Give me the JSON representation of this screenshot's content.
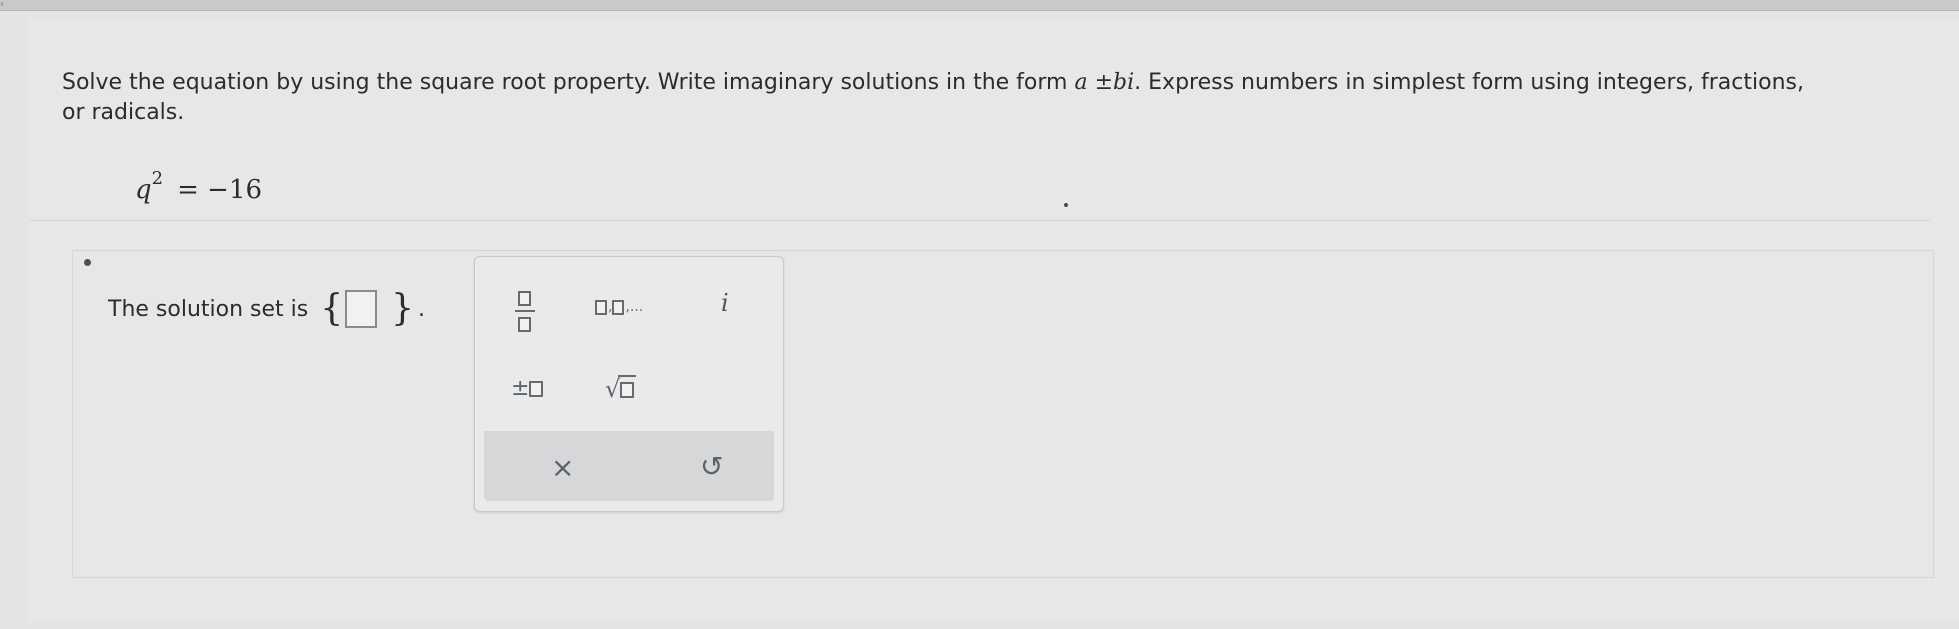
{
  "prompt": {
    "line1": "Solve the equation by using the square root property. Write imaginary solutions in the form ",
    "form": "a ±bi",
    "line1_end": ". Express numbers in simplest form using integers, fractions,",
    "line2": "or radicals."
  },
  "equation": {
    "variable": "q",
    "exponent": "2",
    "rest": "= −16"
  },
  "answer": {
    "label": "The solution set is",
    "open_brace": "{",
    "close_brace": "}",
    "period": "."
  },
  "keypad": {
    "fraction_label": "fraction",
    "list_label": "□,□,...",
    "imag_unit": "i",
    "plus_minus": "±",
    "sqrt_symbol": "√",
    "clear": "×",
    "undo": "↺"
  },
  "icons": {
    "fraction": "fraction-icon",
    "list": "list-icon",
    "imaginary": "imaginary-unit-icon",
    "plus_minus": "plus-minus-icon",
    "sqrt": "square-root-icon",
    "clear": "clear-icon",
    "undo": "undo-icon"
  }
}
